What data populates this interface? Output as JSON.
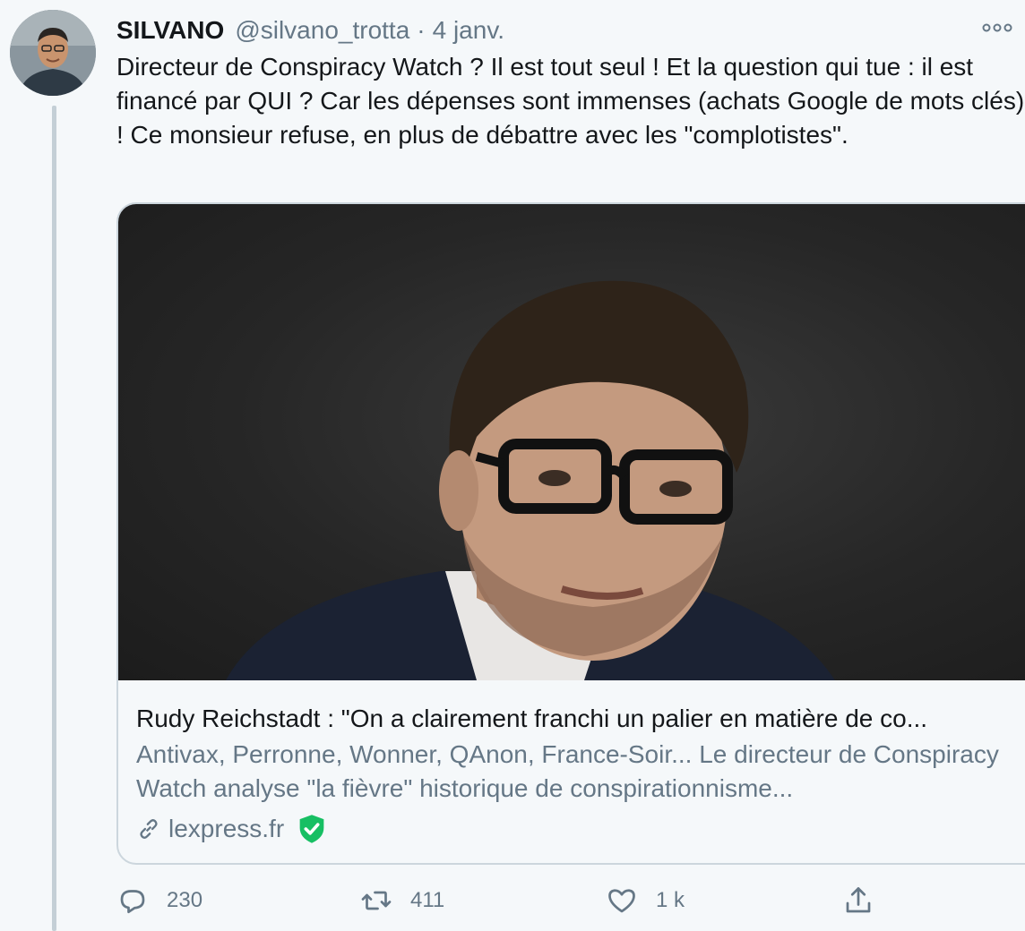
{
  "tweet": {
    "author_name": "SILVANO",
    "handle": "@silvano_trotta",
    "separator": "·",
    "date": "4 janv.",
    "more_icon": "more-dots-icon",
    "text": "Directeur de Conspiracy Watch ? Il est tout seul ! Et la question qui tue : il est financé par QUI ? Car les dépenses sont immenses (achats Google de mots clés) ! Ce monsieur refuse, en plus de débattre avec les \"complotistes\"."
  },
  "card": {
    "title": "Rudy Reichstadt : \"On a clairement franchi un palier en matière de co...",
    "description": "Antivax, Perronne, Wonner, QAnon, France-Soir... Le directeur de Conspiracy Watch analyse \"la fièvre\" historique de conspirationnisme...",
    "domain": "lexpress.fr",
    "link_icon": "link-icon",
    "verified_icon": "verified-shield-icon"
  },
  "actions": {
    "reply_count": "230",
    "retweet_count": "411",
    "like_count": "1 k",
    "reply_icon": "reply-icon",
    "retweet_icon": "retweet-icon",
    "like_icon": "heart-icon",
    "share_icon": "share-icon"
  },
  "colors": {
    "background": "#f5f8fa",
    "text": "#14171a",
    "muted": "#657786",
    "border": "#ccd6dd",
    "verified_green": "#17bf63"
  }
}
